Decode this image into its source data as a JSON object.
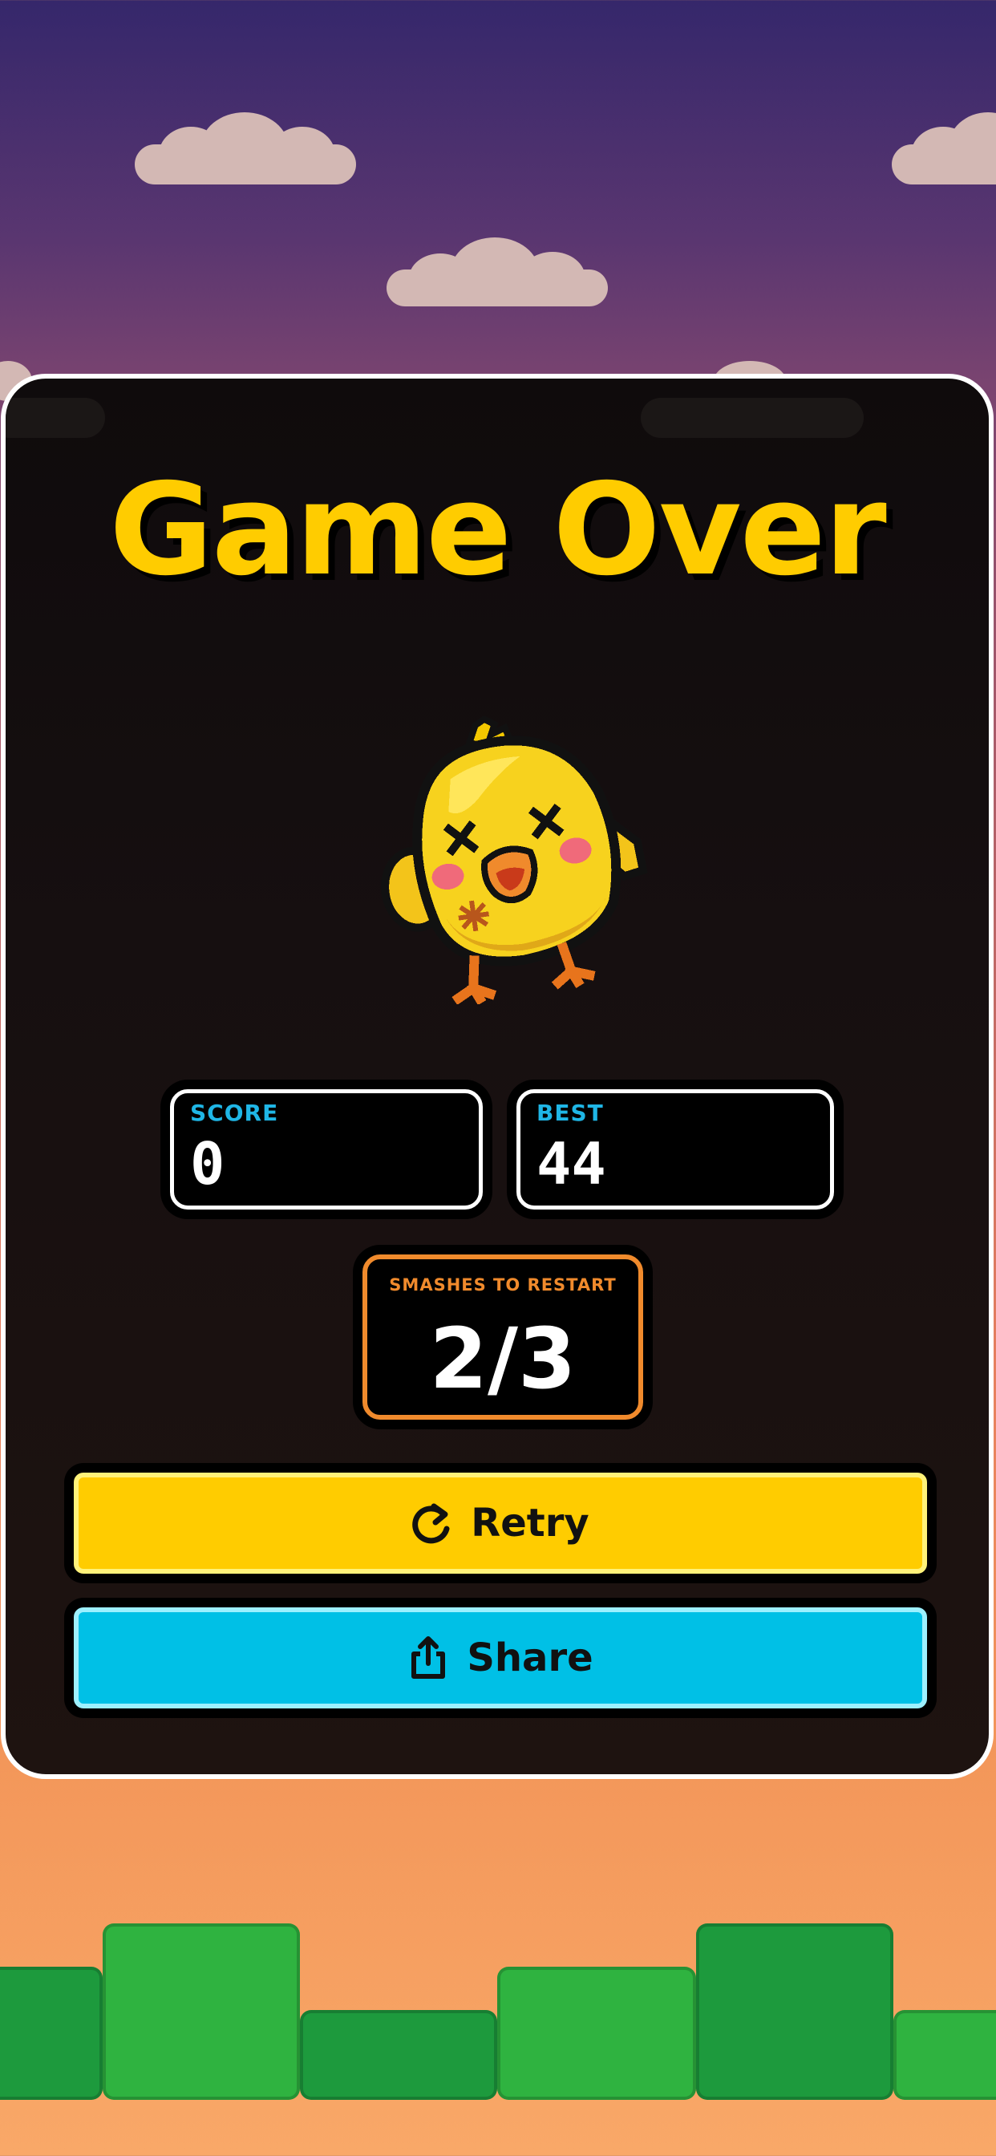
{
  "game": {
    "title": "Game Over",
    "character": "dead-chick",
    "character_icon": "chick-dead-icon"
  },
  "stats": {
    "score": {
      "label": "SCORE",
      "value": "0"
    },
    "best": {
      "label": "BEST",
      "value": "44"
    },
    "restart": {
      "label": "SMASHES TO RESTART",
      "value": "2/3",
      "current": 2,
      "required": 3
    }
  },
  "buttons": {
    "retry": {
      "label": "Retry",
      "icon": "retry-icon"
    },
    "share": {
      "label": "Share",
      "icon": "share-icon"
    }
  },
  "colors": {
    "title": "#ffcc00",
    "stat_label": "#1fb6e6",
    "restart_accent": "#f08a2c",
    "retry_button": "#ffcc00",
    "share_button": "#00c0e6",
    "ground_dark": "#1d9a3d",
    "ground_light": "#2fb340"
  }
}
